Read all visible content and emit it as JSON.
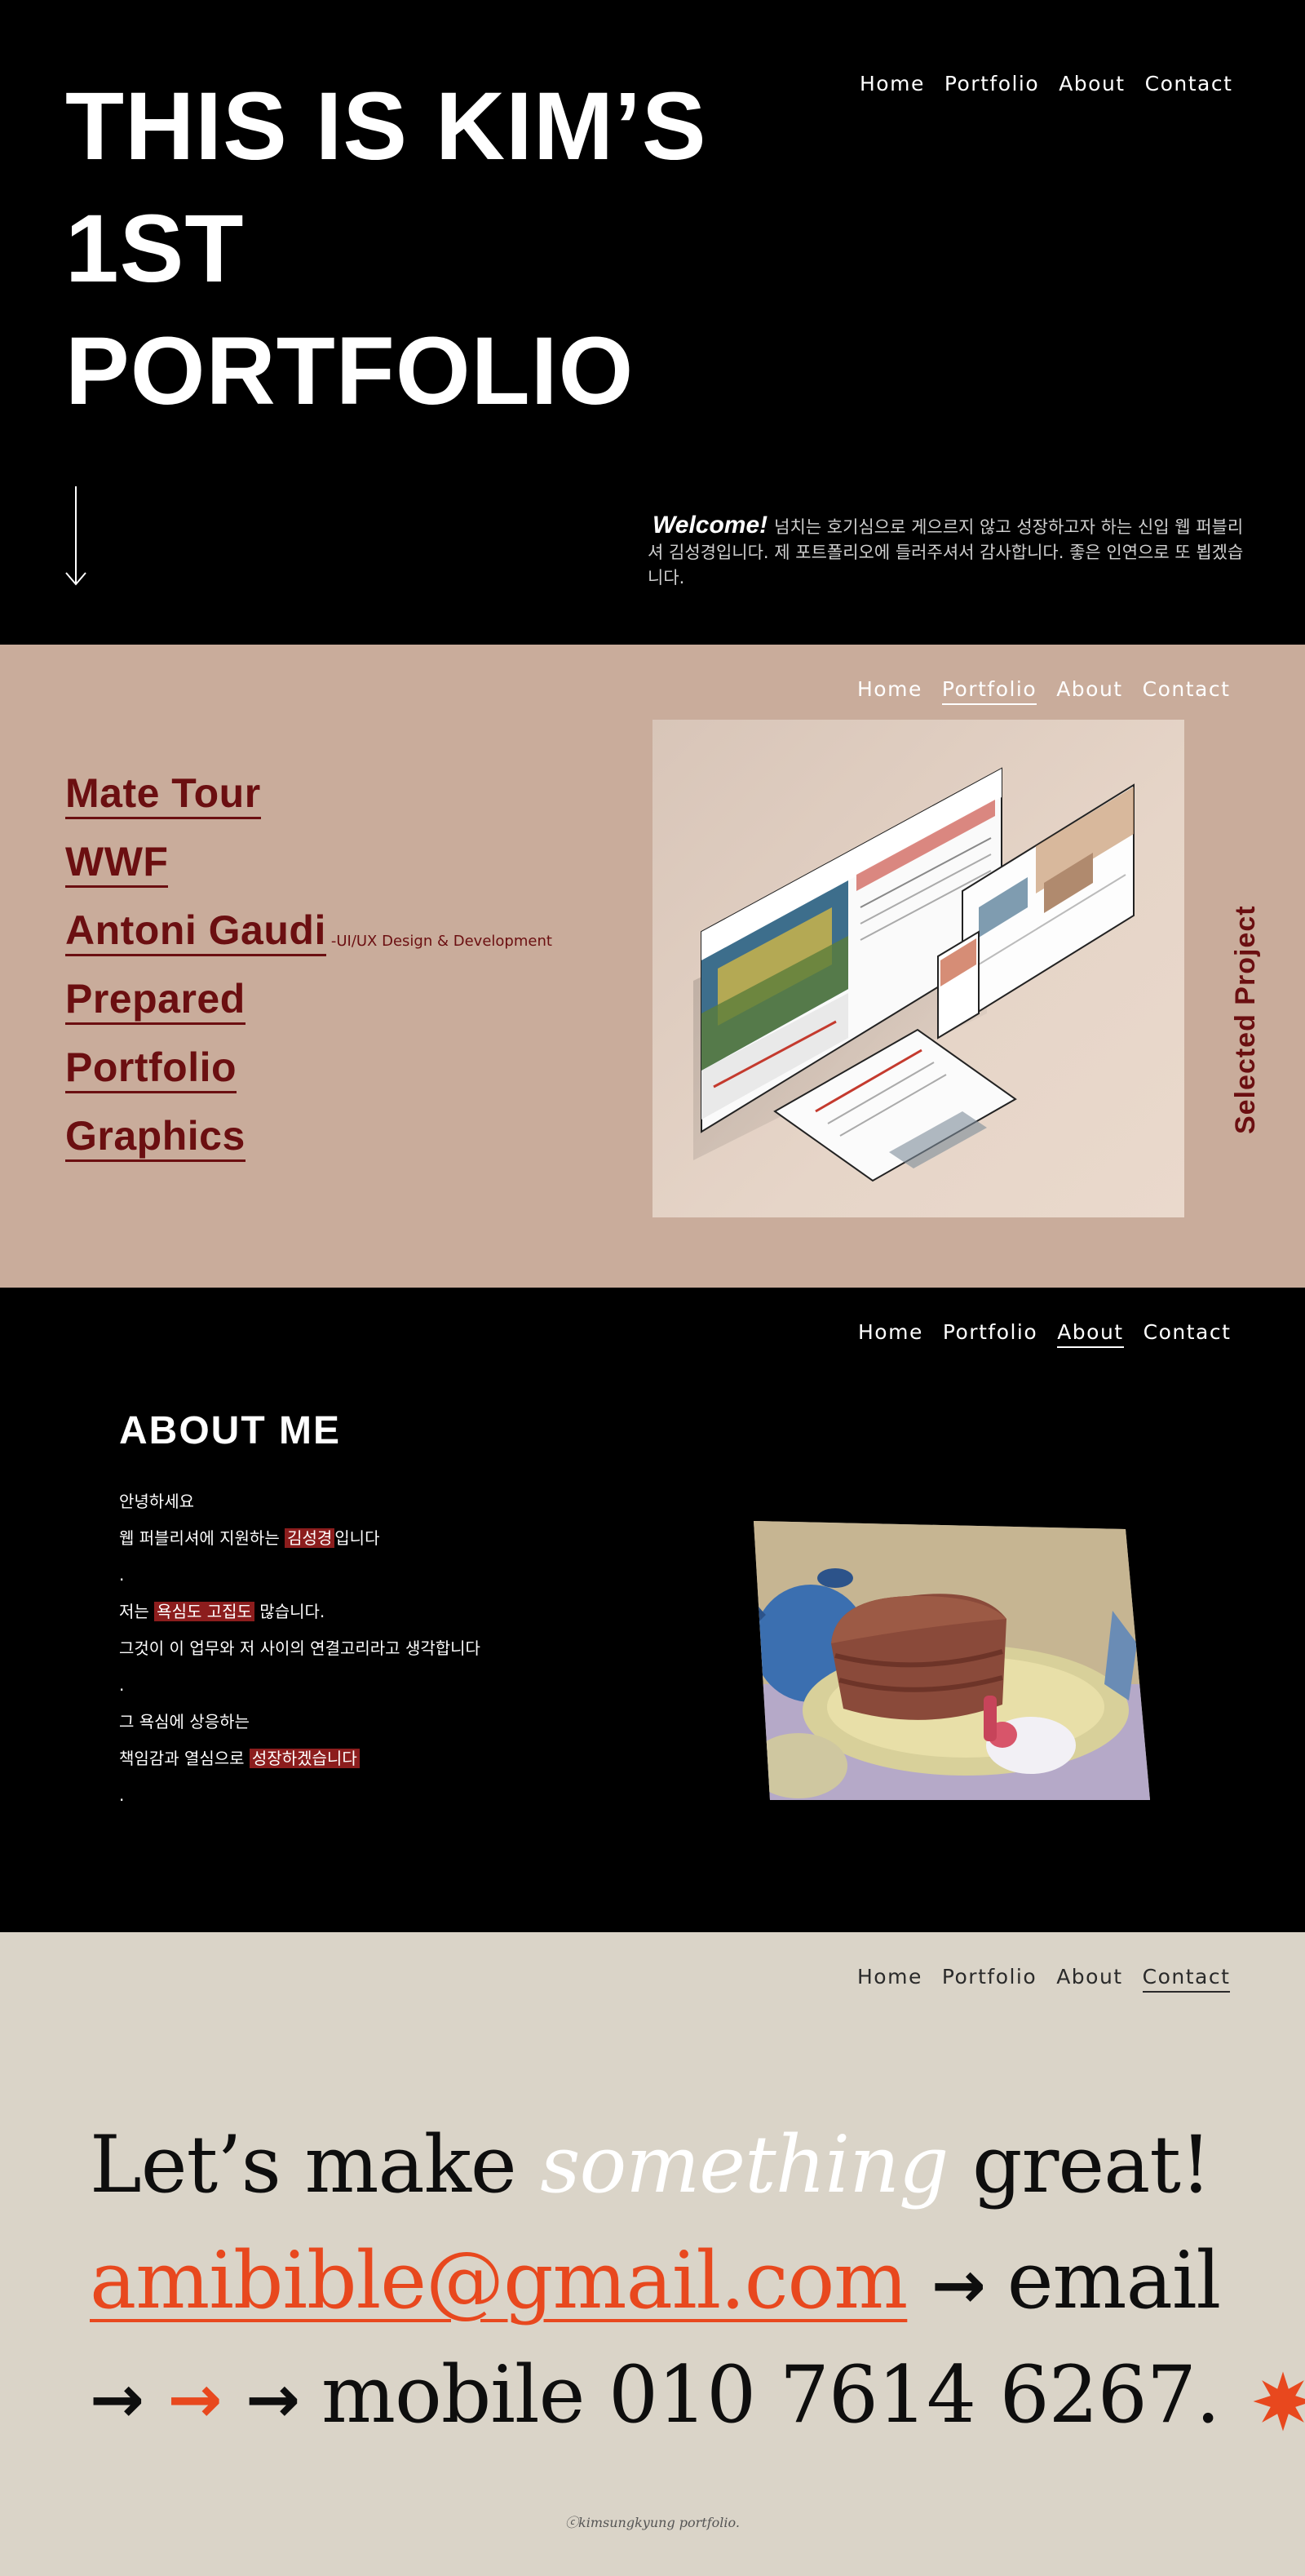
{
  "nav": {
    "home": "Home",
    "portfolio": "Portfolio",
    "about": "About",
    "contact": "Contact"
  },
  "hero": {
    "title_line1": "THIS IS KIM’S",
    "title_line2": "1ST",
    "title_line3": "PORTFOLIO",
    "welcome_label": "Welcome!",
    "welcome_text": "넘치는 호기심으로 게으르지 않고 성장하고자 하는 신입 웹 퍼블리셔 김성경입니다. 제 포트폴리오에 들러주셔서 감사합니다. 좋은 인연으로 또 뵙겠습니다."
  },
  "portfolio": {
    "projects": [
      {
        "label": "Mate Tour"
      },
      {
        "label": "WWF"
      },
      {
        "label": "Antoni Gaudi"
      },
      {
        "label": "Prepared"
      },
      {
        "label": "Portfolio"
      },
      {
        "label": "Graphics"
      }
    ],
    "hover_tag": "-UI/UX Design & Development",
    "vertical_title": "Selected Project"
  },
  "about": {
    "heading": "ABOUT ME",
    "l1": "안녕하세요",
    "l2_pre": "웹 퍼블리셔에 지원하는 ",
    "l2_hl": "김성경",
    "l2_post": "입니다",
    "dot": ".",
    "l4_pre": "저는 ",
    "l4_hl": "욕심도 고집도",
    "l4_post": " 많습니다.",
    "l5": "그것이 이 업무와 저 사이의 연결고리라고 생각합니다",
    "l7": "그 욕심에 상응하는",
    "l8_pre": "책임감과 열심으로 ",
    "l8_hl": "성장하겠습니다"
  },
  "contact": {
    "line1_a": "Let’s make ",
    "line1_b": "something",
    "line1_c": " great!",
    "email": "amibible@gmail.com",
    "email_label": "email",
    "mobile": "mobile 010 7614 6267.",
    "copyright": "ⓒkimsungkyung portfolio."
  },
  "colors": {
    "accent": "#e8481e",
    "burgundy": "#6b0f11",
    "portfolio_bg": "#c9ac9b",
    "contact_bg": "#dad4c8"
  }
}
